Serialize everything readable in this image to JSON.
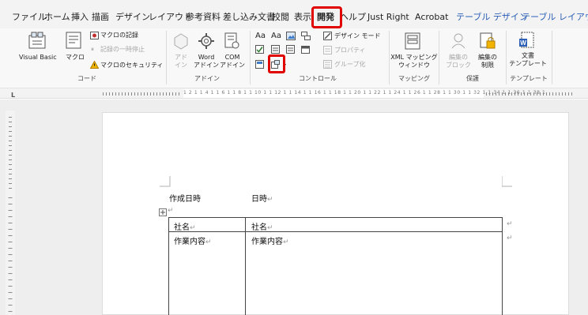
{
  "menu": {
    "tabs": [
      "ファイル",
      "ホーム",
      "挿入",
      "描画",
      "デザイン",
      "レイアウト",
      "参考資料",
      "差し込み文書",
      "校閲",
      "表示",
      "開発",
      "ヘルプ",
      "Just Right",
      "Acrobat",
      "テーブル デザイン",
      "テーブル レイアウト"
    ],
    "active_tab": "開発"
  },
  "ribbon": {
    "code": {
      "label": "コード",
      "visual_basic": "Visual Basic",
      "macro": "マクロ",
      "record_macro": "マクロの記録",
      "pause_recording": "記録の一時停止",
      "macro_security": "マクロのセキュリティ"
    },
    "addins": {
      "label": "アドイン",
      "addins_line1": "アド",
      "addins_line2": "イン",
      "word_addins_line1": "Word",
      "word_addins_line2": "アドイン",
      "com_addins_line1": "COM",
      "com_addins_line2": "アドイン"
    },
    "controls": {
      "label": "コントロール",
      "rich_text": "Aa",
      "plain_text": "Aa",
      "design_mode": "デザイン モード",
      "properties": "プロパティ",
      "group": "グループ化"
    },
    "mapping": {
      "label": "マッピング",
      "xml_line1": "XML マッピング",
      "xml_line2": "ウィンドウ"
    },
    "protect": {
      "label": "保護",
      "block_authors_line1": "編集の",
      "block_authors_line2": "ブロック",
      "restrict_line1": "編集の",
      "restrict_line2": "制限"
    },
    "templates": {
      "label": "テンプレート",
      "doc_template_line1": "文書",
      "doc_template_line2": "テンプレート"
    }
  },
  "ruler": {
    "numbers": "1 2 1   1 4 1   1 6 1   1 8 1   1 10 1   1 12 1   1 14 1   1 16 1   1 18 1   1 20 1   1 22 1   1 24 1   1 26 1   1 28 1   1 30 1   1 32 1   1 34 1   1 36 1   1 38 1"
  },
  "document": {
    "created_label": "作成日時",
    "date_label": "日時",
    "table": {
      "headers": [
        "社名",
        "社名"
      ],
      "row_labels": [
        "作業内容",
        "作業内容"
      ]
    },
    "para_mark": "↵"
  },
  "colors": {
    "accent_tab": "#2b5fb8",
    "highlight": "#e00000"
  }
}
